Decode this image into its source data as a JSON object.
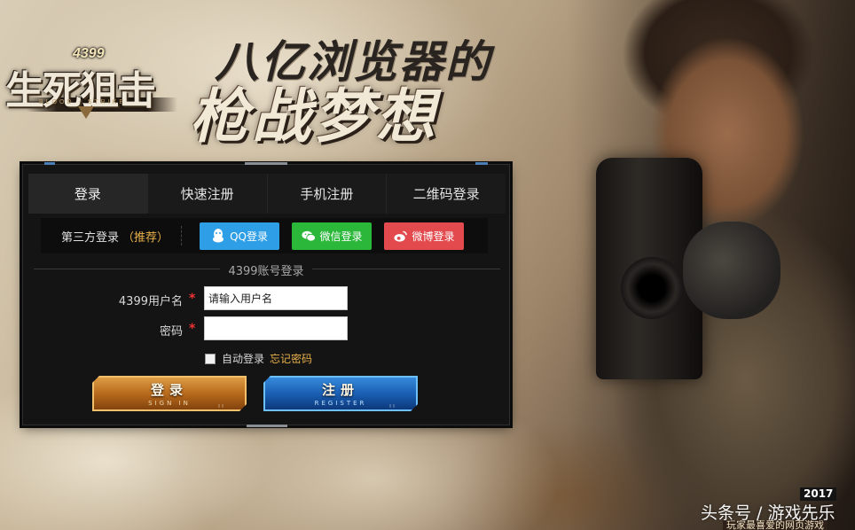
{
  "logo": {
    "number": "4399",
    "title": "生死狙击",
    "subtitle": "BLOOD · STRIKE"
  },
  "slogan": {
    "line1": "八亿浏览器的",
    "line2": "枪战梦想"
  },
  "tabs": [
    {
      "label": "登录"
    },
    {
      "label": "快速注册"
    },
    {
      "label": "手机注册"
    },
    {
      "label": "二维码登录"
    }
  ],
  "third_party": {
    "label": "第三方登录",
    "recommend": "（推荐）",
    "qq": "QQ登录",
    "wechat": "微信登录",
    "weibo": "微博登录"
  },
  "form": {
    "section_title": "4399账号登录",
    "username_label": "4399用户名",
    "username_placeholder": "请输入用户名",
    "password_label": "密码",
    "required_mark": "*",
    "auto_login": "自动登录",
    "forgot_password": "忘记密码"
  },
  "buttons": {
    "login_main": "登录",
    "login_sub": "SIGN IN",
    "register_main": "注册",
    "register_sub": "REGISTER"
  },
  "watermark": {
    "year": "2017",
    "text": "头条号 / 游戏先乐",
    "sub": "玩家最喜爱的网页游戏"
  },
  "colors": {
    "qq": "#2e9ee6",
    "wechat": "#2bb73a",
    "weibo": "#e24a4e",
    "accent_orange": "#e8b04a",
    "required": "#e33333"
  }
}
